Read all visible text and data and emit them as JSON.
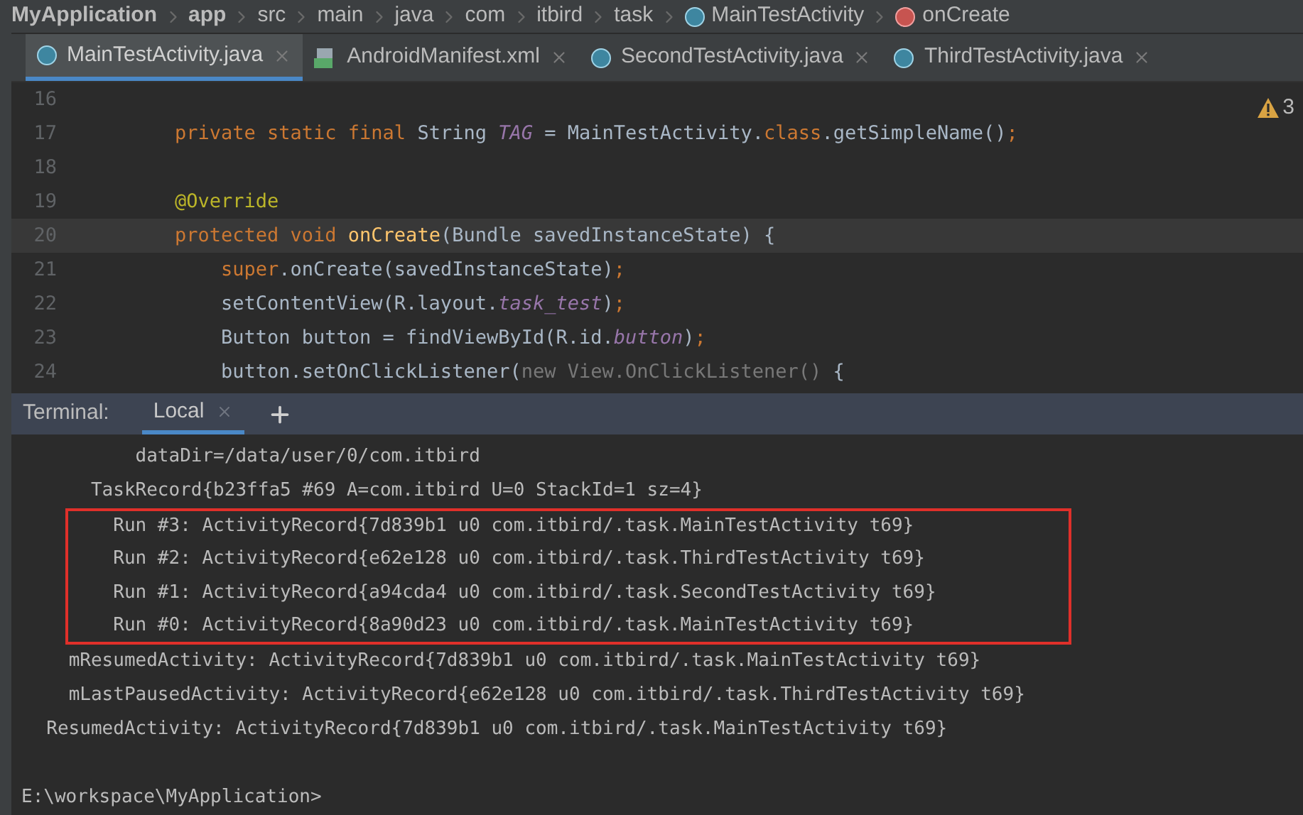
{
  "breadcrumb": [
    {
      "text": "MyApplication",
      "bold": true,
      "kind": "segment"
    },
    {
      "text": "app",
      "bold": true,
      "kind": "segment"
    },
    {
      "text": "src",
      "bold": false,
      "kind": "segment"
    },
    {
      "text": "main",
      "bold": false,
      "kind": "segment"
    },
    {
      "text": "java",
      "bold": false,
      "kind": "segment"
    },
    {
      "text": "com",
      "bold": false,
      "kind": "segment"
    },
    {
      "text": "itbird",
      "bold": false,
      "kind": "segment"
    },
    {
      "text": "task",
      "bold": false,
      "kind": "segment"
    },
    {
      "text": "MainTestActivity",
      "bold": false,
      "kind": "class"
    },
    {
      "text": "onCreate",
      "bold": false,
      "kind": "method"
    }
  ],
  "tabs": [
    {
      "label": "MainTestActivity.java",
      "kind": "class",
      "selected": true
    },
    {
      "label": "AndroidManifest.xml",
      "kind": "manifest",
      "selected": false
    },
    {
      "label": "SecondTestActivity.java",
      "kind": "class",
      "selected": false
    },
    {
      "label": "ThirdTestActivity.java",
      "kind": "class",
      "selected": false
    }
  ],
  "editor": {
    "warning_count": "3",
    "lines": [
      {
        "number": "16",
        "current": false
      },
      {
        "number": "17",
        "current": false,
        "tokens": [
          {
            "text": "private static final ",
            "kind": "keyword"
          },
          {
            "text": "String ",
            "kind": "plain"
          },
          {
            "text": "TAG",
            "kind": "field"
          },
          {
            "text": " = MainTestActivity.",
            "kind": "plain"
          },
          {
            "text": "class",
            "kind": "keyword"
          },
          {
            "text": ".getSimpleName()",
            "kind": "plain"
          },
          {
            "text": ";",
            "kind": "keyword"
          }
        ]
      },
      {
        "number": "18",
        "current": false
      },
      {
        "number": "19",
        "current": false,
        "tokens": [
          {
            "text": "@Override",
            "kind": "annotation"
          }
        ]
      },
      {
        "number": "20",
        "current": true,
        "tokens": [
          {
            "text": "protected void ",
            "kind": "keyword"
          },
          {
            "text": "onCreate",
            "kind": "method"
          },
          {
            "text": "(Bundle savedInstanceState) {",
            "kind": "plain"
          }
        ]
      },
      {
        "number": "21",
        "current": false,
        "tokens": [
          {
            "text": "    super",
            "kind": "keyword"
          },
          {
            "text": ".onCreate(savedInstanceState)",
            "kind": "plain"
          },
          {
            "text": ";",
            "kind": "keyword"
          }
        ]
      },
      {
        "number": "22",
        "current": false,
        "tokens": [
          {
            "text": "    setContentView(R.layout.",
            "kind": "plain"
          },
          {
            "text": "task_test",
            "kind": "field"
          },
          {
            "text": ")",
            "kind": "plain"
          },
          {
            "text": ";",
            "kind": "keyword"
          }
        ]
      },
      {
        "number": "23",
        "current": false,
        "tokens": [
          {
            "text": "    Button button = findViewById(R.id.",
            "kind": "plain"
          },
          {
            "text": "button",
            "kind": "field"
          },
          {
            "text": ")",
            "kind": "plain"
          },
          {
            "text": ";",
            "kind": "keyword"
          }
        ]
      },
      {
        "number": "24",
        "current": false,
        "tokens": [
          {
            "text": "    button.setOnClickListener(",
            "kind": "plain"
          },
          {
            "text": "new View.OnClickListener()",
            "kind": "faded"
          },
          {
            "text": " {",
            "kind": "plain"
          }
        ]
      }
    ]
  },
  "terminal": {
    "label": "Terminal:",
    "tabs": [
      {
        "label": "Local",
        "selected": true
      }
    ],
    "output": [
      {
        "text": "          dataDir=/data/user/0/com.itbird",
        "highlighted": false
      },
      {
        "text": "      TaskRecord{b23ffa5 #69 A=com.itbird U=0 StackId=1 sz=4}",
        "highlighted": false
      },
      {
        "text": "        Run #3: ActivityRecord{7d839b1 u0 com.itbird/.task.MainTestActivity t69}",
        "highlighted": true
      },
      {
        "text": "        Run #2: ActivityRecord{e62e128 u0 com.itbird/.task.ThirdTestActivity t69}",
        "highlighted": true
      },
      {
        "text": "        Run #1: ActivityRecord{a94cda4 u0 com.itbird/.task.SecondTestActivity t69}",
        "highlighted": true
      },
      {
        "text": "        Run #0: ActivityRecord{8a90d23 u0 com.itbird/.task.MainTestActivity t69}",
        "highlighted": true
      },
      {
        "text": "    mResumedActivity: ActivityRecord{7d839b1 u0 com.itbird/.task.MainTestActivity t69}",
        "highlighted": false
      },
      {
        "text": "    mLastPausedActivity: ActivityRecord{e62e128 u0 com.itbird/.task.ThirdTestActivity t69}",
        "highlighted": false
      },
      {
        "text": "  ResumedActivity: ActivityRecord{7d839b1 u0 com.itbird/.task.MainTestActivity t69}",
        "highlighted": false
      }
    ],
    "prompt": "E:\\workspace\\MyApplication>"
  }
}
